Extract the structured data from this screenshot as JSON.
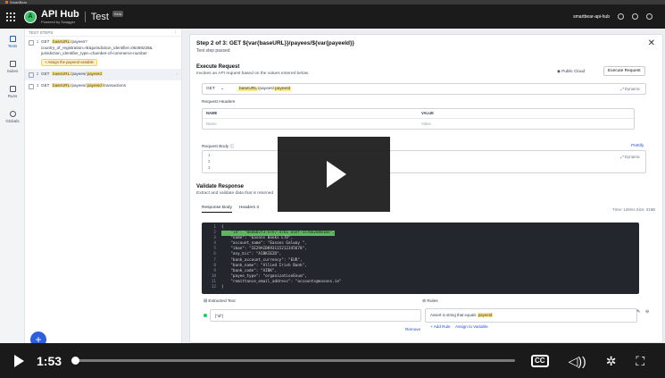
{
  "browser_tab": {
    "label": "SmartBear"
  },
  "app": {
    "brand": "API Hub",
    "brand_sub": "Powered by Swagger",
    "project": "Test",
    "badge": "Beta",
    "org": "smartbear-api-hub"
  },
  "rail": [
    {
      "label": "Tests",
      "icon": "tests-icon",
      "active": true
    },
    {
      "label": "Suites",
      "icon": "suites-icon",
      "active": false
    },
    {
      "label": "Runs",
      "icon": "runs-icon",
      "active": false
    },
    {
      "label": "Globals",
      "icon": "globals-icon",
      "active": false
    }
  ],
  "steps_panel": {
    "header": "TEST STEPS",
    "menu_glyph": "⋮",
    "steps": [
      {
        "num": "1",
        "method": "GET",
        "var": "baseURL",
        "path_line1": "/payees?",
        "path_line2": "country_of_registration=IE&jurisdiction_identifier=06469228&",
        "path_line3": "jurisdiction_identifier_type=chamber-of-commerce-number",
        "assign": "+ Assign the payeeId variable"
      },
      {
        "num": "2",
        "method": "GET",
        "var": "baseURL",
        "path": "/payees/",
        "var2": "payeeId"
      },
      {
        "num": "3",
        "method": "GET",
        "var": "baseURL",
        "path": "/payees/",
        "var2": "payeeId",
        "path_end": "/transactions"
      }
    ]
  },
  "detail": {
    "title": "Step 2 of 3:  GET ${var{baseURL}}/payees/${var{payeeId}}",
    "status": "Test step passed",
    "close_glyph": "✕",
    "execute": {
      "title": "Execute Request",
      "subtitle": "Invokes an API request based on the values entered below.",
      "cloud_label": "Public Cloud",
      "button": "Execute Request",
      "method": "GET",
      "url_var": "baseURL",
      "url_path": "/payees/",
      "url_var2": "payeeId",
      "dynamic": "Dynamic",
      "headers_label": "Request Headers",
      "col_name": "NAME",
      "col_value": "VALUE",
      "ph_name": "Name",
      "ph_value": "Value",
      "body_label": "Request Body",
      "prettify": "Prettify",
      "body_lines": [
        "1",
        "2",
        "3"
      ]
    },
    "validate": {
      "title": "Validate Response",
      "subtitle": "Extract and validate data that is returned",
      "tab_body": "Response Body",
      "tab_headers": "Headers",
      "headers_count": "3",
      "meta": "Time: 125ms   Size: 318B",
      "code": [
        {
          "n": "1",
          "t": "{"
        },
        {
          "n": "2",
          "t": "    \"id\": \"0eb603f3-e7e7-47b1-a5ef-557b6204816e\",",
          "hl": true
        },
        {
          "n": "3",
          "t": "    \"name\": \"Easons Books LTD\","
        },
        {
          "n": "4",
          "t": "    \"account_name\": \"Easons Galway \","
        },
        {
          "n": "5",
          "t": "    \"iban\": \"IE29AIBK93115212345678\","
        },
        {
          "n": "6",
          "t": "    \"any_bic\": \"AIBKIE2D\","
        },
        {
          "n": "7",
          "t": "    \"bank_account_currency\": \"EUR\","
        },
        {
          "n": "8",
          "t": "    \"bank_name\": \"Allied Irish Bank\","
        },
        {
          "n": "9",
          "t": "    \"bank_code\": \"AIBK\","
        },
        {
          "n": "10",
          "t": "    \"payee_type\": \"organizationEnum\","
        },
        {
          "n": "11",
          "t": "    \"remittance_email_address\": \"accounts@easons.ie\""
        },
        {
          "n": "12",
          "t": "}"
        }
      ],
      "extracted_label": "Extracted Text",
      "rules_label": "Rules",
      "extract_value": "[\"id\"]",
      "rule_text": "Assert is string that equals",
      "rule_var": "payeeId",
      "remove": "Remove",
      "add_rule": "+ Add Rule",
      "assign_var": "Assign to Variable"
    }
  },
  "player": {
    "time": "1:53",
    "progress": 0.005,
    "cc": "CC"
  }
}
